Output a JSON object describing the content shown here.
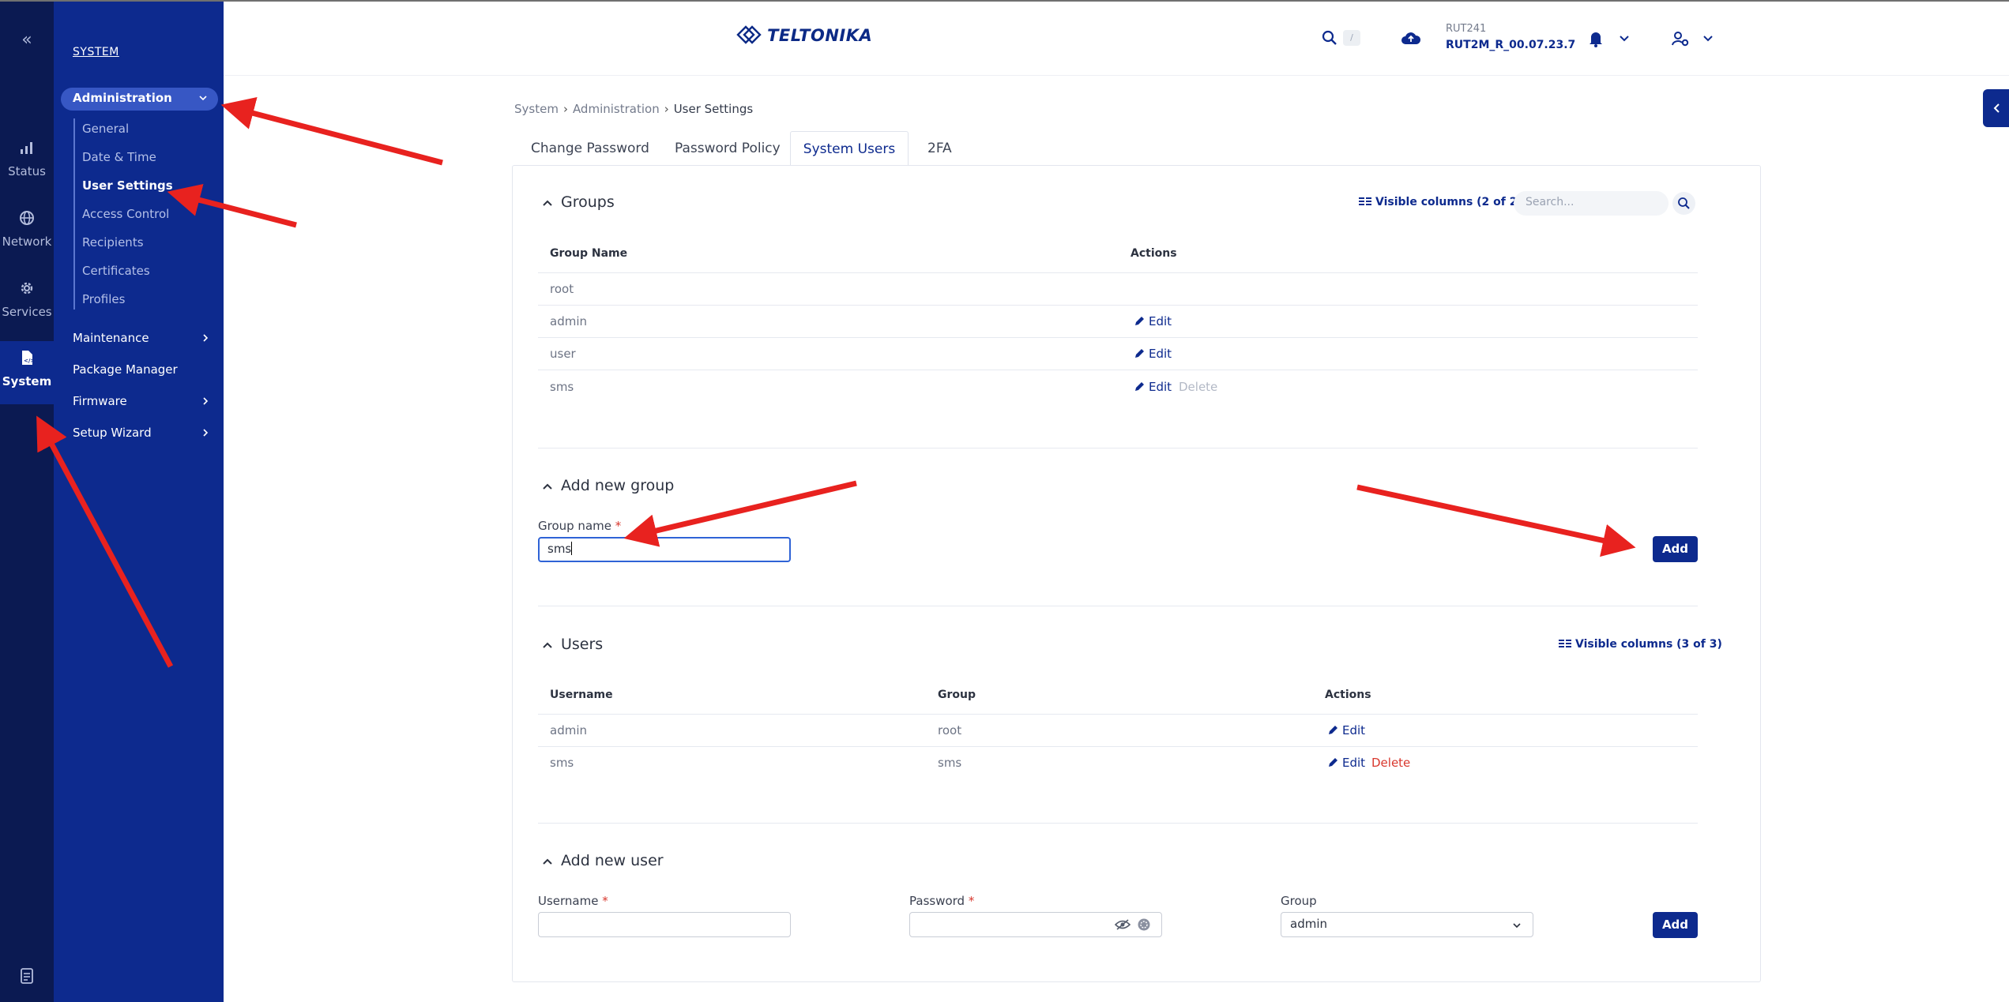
{
  "rail": {
    "items": [
      {
        "label": "Status",
        "icon": "status-icon"
      },
      {
        "label": "Network",
        "icon": "globe-icon"
      },
      {
        "label": "Services",
        "icon": "gear-icon"
      },
      {
        "label": "System",
        "icon": "system-icon"
      }
    ]
  },
  "subnav": {
    "title": "SYSTEM",
    "administration": "Administration",
    "admin_items": [
      "General",
      "Date & Time",
      "User Settings",
      "Access Control",
      "Recipients",
      "Certificates",
      "Profiles"
    ],
    "items": [
      "Maintenance",
      "Package Manager",
      "Firmware",
      "Setup Wizard"
    ]
  },
  "header": {
    "logo": "TELTONIKA",
    "search_shortcut": "/",
    "device_name": "RUT241",
    "firmware": "RUT2M_R_00.07.23.7"
  },
  "breadcrumb": [
    "System",
    "Administration",
    "User Settings"
  ],
  "tabs": [
    "Change Password",
    "Password Policy",
    "System Users",
    "2FA"
  ],
  "groups": {
    "title": "Groups",
    "visible_columns": "Visible columns (2 of 2)",
    "search_placeholder": "Search...",
    "columns": [
      "Group Name",
      "Actions"
    ],
    "rows": [
      {
        "name": "root"
      },
      {
        "name": "admin",
        "edit": "Edit"
      },
      {
        "name": "user",
        "edit": "Edit"
      },
      {
        "name": "sms",
        "edit": "Edit",
        "delete": "Delete"
      }
    ]
  },
  "add_group": {
    "title": "Add new group",
    "label": "Group name",
    "required": "*",
    "value": "sms",
    "button": "Add"
  },
  "users": {
    "title": "Users",
    "visible_columns": "Visible columns (3 of 3)",
    "columns": [
      "Username",
      "Group",
      "Actions"
    ],
    "rows": [
      {
        "username": "admin",
        "group": "root",
        "edit": "Edit"
      },
      {
        "username": "sms",
        "group": "sms",
        "edit": "Edit",
        "delete": "Delete"
      }
    ]
  },
  "add_user": {
    "title": "Add new user",
    "username_label": "Username",
    "password_label": "Password",
    "group_label": "Group",
    "required": "*",
    "group_value": "admin",
    "button": "Add"
  },
  "colors": {
    "rail": "#0b1a52",
    "subnav": "#0d2a8e",
    "accent": "#0d2a8e",
    "danger": "#d8372d",
    "annotation_arrow": "#e8221f"
  }
}
